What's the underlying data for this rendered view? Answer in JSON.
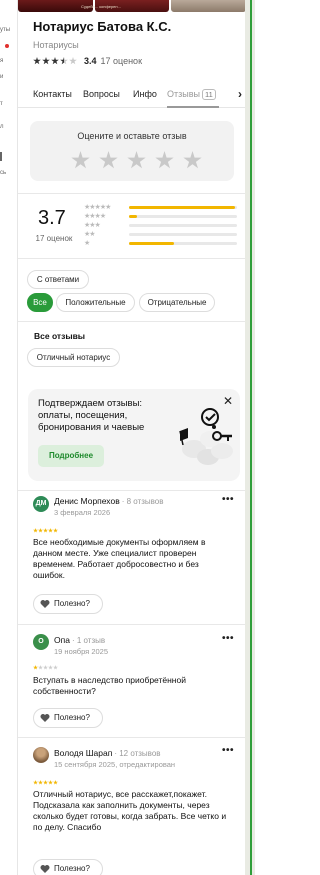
{
  "left_fragments": [
    "уты",
    "я",
    "и",
    "т",
    "л",
    "сь"
  ],
  "place": {
    "photo_caption": "Судебн... конферен...",
    "title": "Нотариус Батова К.С.",
    "category": "Нотариусы",
    "rating": "3.4",
    "ratings_count": "17 оценок"
  },
  "tabs": [
    {
      "label": "Контакты"
    },
    {
      "label": "Вопросы"
    },
    {
      "label": "Инфо"
    },
    {
      "label": "Отзывы",
      "badge": "11",
      "active": true
    }
  ],
  "rate_prompt": "Оцените и оставьте отзыв",
  "summary": {
    "score": "3.7",
    "count": "17 оценок",
    "distribution": [
      {
        "stars": 5,
        "fraction": 0.98
      },
      {
        "stars": 4,
        "fraction": 0.07
      },
      {
        "stars": 3,
        "fraction": 0.0
      },
      {
        "stars": 2,
        "fraction": 0.0
      },
      {
        "stars": 1,
        "fraction": 0.42
      }
    ]
  },
  "filters": {
    "with_answers": "С ответами",
    "all": "Все",
    "positive": "Положительные",
    "negative": "Отрицательные"
  },
  "all_reviews_title": "Все отзывы",
  "tag_chip": "Отличный нотариус",
  "promo": {
    "text": "Подтверждаем отзывы: оплаты, посещения, бронирования и чаевые",
    "button": "Подробнее"
  },
  "useful_label": "Полезно?",
  "reviews": [
    {
      "initials": "ДМ",
      "avatar_color": "#2e8b57",
      "name": "Денис Морпехов",
      "reviews_count": "· 8 отзывов",
      "date": "3 февраля 2026",
      "stars": 5,
      "text": "Все необходимые документы оформляем в данном месте. Уже специалист проверен временем. Работает добросовестно и без ошибок."
    },
    {
      "initials": "О",
      "avatar_color": "#3a8f4a",
      "name": "Опа",
      "reviews_count": "· 1 отзыв",
      "date": "19 ноября 2025",
      "stars": 1,
      "text": "Вступать в наследство приобретённой собственности?"
    },
    {
      "initials": "",
      "avatar_color": "#8a6a4a",
      "name": "Володя Шарап",
      "reviews_count": "· 12 отзывов",
      "date": "15 сентября 2025, отредактирован",
      "stars": 5,
      "text": "Отличный нотариус, все расскажет,покажет. Подсказала как заполнить документы, через сколько будет готовы, когда забрать. Все четко и по делу. Спасибо"
    }
  ]
}
